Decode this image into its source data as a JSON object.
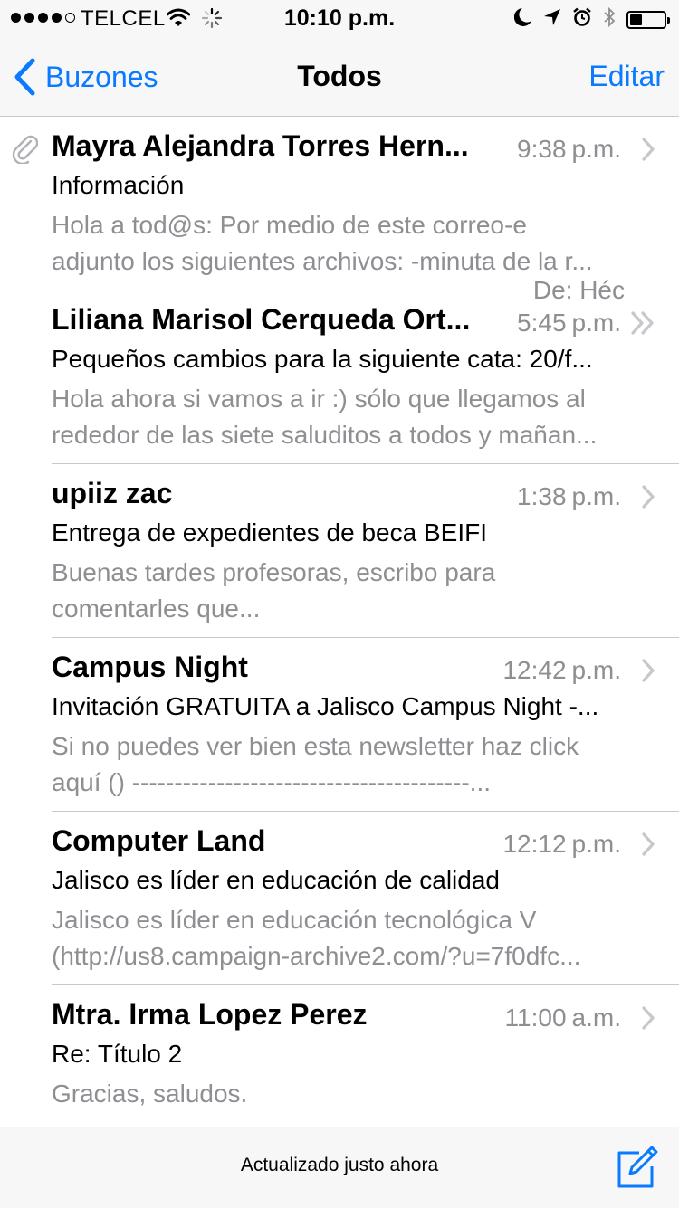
{
  "status_bar": {
    "carrier": "TELCEL",
    "time": "10:10 p.m.",
    "battery_level": 0.35,
    "icons": [
      "signal-dots",
      "wifi-icon",
      "activity-icon",
      "moon-icon",
      "location-arrow-icon",
      "alarm-icon",
      "bluetooth-icon",
      "battery-icon"
    ]
  },
  "nav": {
    "back_label": "Buzones",
    "title": "Todos",
    "edit_label": "Editar"
  },
  "accent_color": "#0a7aff",
  "messages": [
    {
      "sender": "Mayra Alejandra Torres Hern...",
      "time": "9:38",
      "period": "p.m.",
      "subject": "Información",
      "preview_line1": "Hola a tod@s: Por medio de este correo-e",
      "preview_line2": "adjunto los siguientes archivos: -minuta de la r...",
      "has_attachment": true,
      "chevron": "chevron-right"
    },
    {
      "sender": "Liliana Marisol Cerqueda Ort...",
      "time": "5:45",
      "period": "p.m.",
      "subject": "Pequeños cambios para la siguiente cata: 20/f...",
      "preview_line1": "Hola ahora si vamos a ir :) sólo que llegamos al",
      "preview_line2": "rededor de las siete saluditos a todos y mañan...",
      "has_attachment": false,
      "chevron": "double-chevron-right"
    },
    {
      "sender": "upiiz zac",
      "time": "1:38",
      "period": "p.m.",
      "subject": "Entrega de expedientes de beca BEIFI",
      "preview_line1": "Buenas tardes profesoras, escribo para",
      "preview_line2": "comentarles que...",
      "has_attachment": false,
      "chevron": "chevron-right"
    },
    {
      "sender": "Campus Night",
      "time": "12:42",
      "period": "p.m.",
      "subject": "Invitación GRATUITA a Jalisco Campus Night -...",
      "preview_line1": "Si no puedes ver bien esta newsletter haz click",
      "preview_line2": "aquí () ----------------------------------------...",
      "has_attachment": false,
      "chevron": "chevron-right"
    },
    {
      "sender": "Computer Land",
      "time": "12:12",
      "period": "p.m.",
      "subject": "Jalisco es líder en educación de calidad",
      "preview_line1": "Jalisco es líder en educación tecnológica V",
      "preview_line2": "(http://us8.campaign-archive2.com/?u=7f0dfc...",
      "has_attachment": false,
      "chevron": "chevron-right"
    },
    {
      "sender": "Mtra. Irma Lopez Perez",
      "time": "11:00",
      "period": "a.m.",
      "subject": "Re: Título 2",
      "preview_line1": "Gracias, saludos.",
      "preview_line2": "",
      "has_attachment": false,
      "chevron": "chevron-right"
    }
  ],
  "peek_text": "De: Héc",
  "toolbar": {
    "status": "Actualizado justo ahora"
  }
}
